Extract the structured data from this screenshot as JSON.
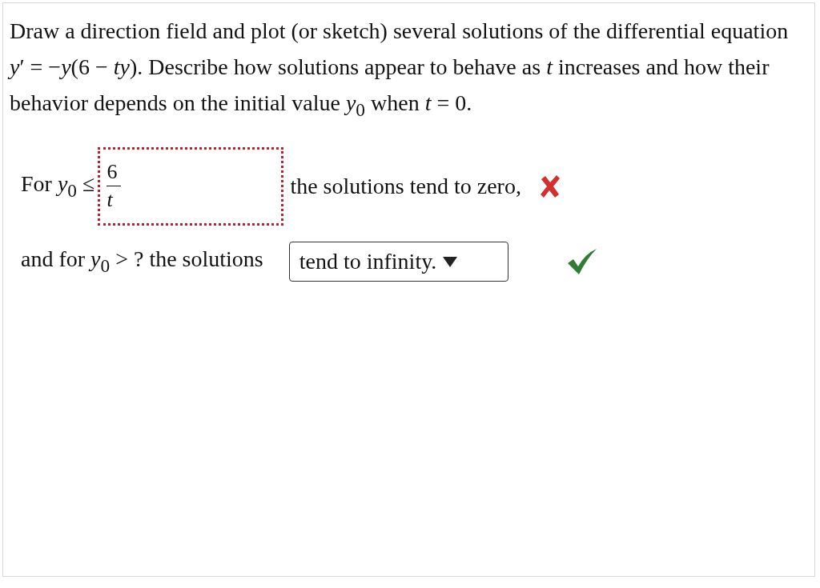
{
  "question": "Draw a direction field and plot (or sketch) several solutions of the differential equation *y*′ = −*y*(6 − *ty*). Describe how solutions appear to behave as *t* increases and how their behavior depends on the initial value *y*$_{0}$ when *t* = 0.",
  "parts": [
    {
      "kind": "fraction",
      "prefix": "For *y*$_{0}$ ≤",
      "numerator": "6",
      "denominator": "t",
      "suffix": "the solutions tend to zero,",
      "correct": false
    },
    {
      "kind": "dropdown",
      "prefix": "and for *y*$_{0}$ > ? the solutions",
      "value": "tend to infinity.",
      "correct": true
    }
  ]
}
